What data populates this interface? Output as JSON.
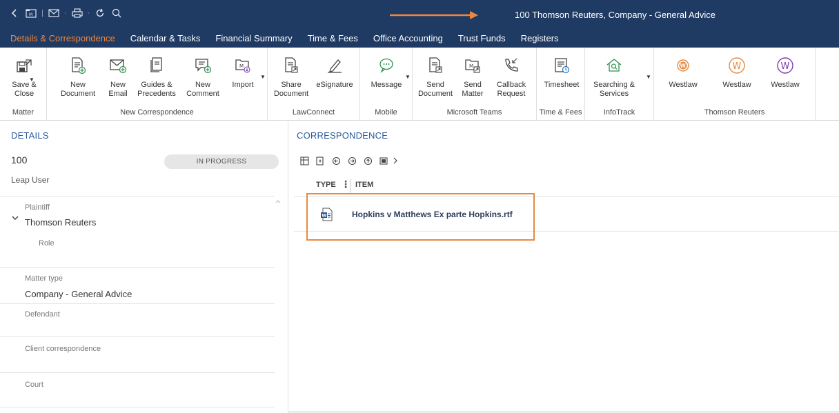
{
  "window": {
    "title": "100 Thomson Reuters, Company - General Advice"
  },
  "quick_access": {
    "icons": [
      "back-icon",
      "matter-icon",
      "email-icon",
      "print-icon",
      "refresh-icon",
      "search-icon"
    ]
  },
  "tabs": [
    {
      "label": "Details & Correspondence",
      "active": true
    },
    {
      "label": "Calendar & Tasks"
    },
    {
      "label": "Financial Summary"
    },
    {
      "label": "Time & Fees"
    },
    {
      "label": "Office Accounting"
    },
    {
      "label": "Trust Funds"
    },
    {
      "label": "Registers"
    }
  ],
  "ribbon": {
    "groups": {
      "matter": {
        "label": "Matter",
        "buttons": [
          {
            "label": "Save &\nClose"
          }
        ]
      },
      "new_correspondence": {
        "label": "New Correspondence",
        "buttons": [
          {
            "label": "New\nDocument"
          },
          {
            "label": "New\nEmail"
          },
          {
            "label": "Guides &\nPrecedents"
          },
          {
            "label": "New\nComment"
          },
          {
            "label": "Import"
          }
        ]
      },
      "lawconnect": {
        "label": "LawConnect",
        "buttons": [
          {
            "label": "Share\nDocument"
          },
          {
            "label": "eSignature"
          }
        ]
      },
      "mobile": {
        "label": "Mobile",
        "buttons": [
          {
            "label": "Message"
          }
        ]
      },
      "teams": {
        "label": "Microsoft Teams",
        "buttons": [
          {
            "label": "Send\nDocument"
          },
          {
            "label": "Send\nMatter"
          },
          {
            "label": "Callback\nRequest"
          }
        ]
      },
      "time_fees": {
        "label": "Time & Fees",
        "buttons": [
          {
            "label": "Timesheet"
          }
        ]
      },
      "infotrack": {
        "label": "InfoTrack",
        "buttons": [
          {
            "label": "Searching &\nServices"
          }
        ]
      },
      "thomson": {
        "label": "Thomson Reuters",
        "buttons": [
          {
            "label": "Westlaw"
          },
          {
            "label": "Westlaw"
          },
          {
            "label": "Westlaw"
          }
        ]
      }
    }
  },
  "details": {
    "title": "DETAILS",
    "matter_number": "100",
    "status": "IN PROGRESS",
    "user": "Leap User",
    "fields": {
      "plaintiff_label": "Plaintiff",
      "plaintiff_value": "Thomson Reuters",
      "role_label": "Role",
      "matter_type_label": "Matter type",
      "matter_type_value": "Company - General Advice",
      "defendant_label": "Defendant",
      "client_corr_label": "Client correspondence",
      "court_label": "Court"
    }
  },
  "correspondence": {
    "title": "CORRESPONDENCE",
    "columns": {
      "type": "TYPE",
      "item": "ITEM"
    },
    "rows": [
      {
        "type_icon": "word-document-icon",
        "name": "Hopkins v Matthews Ex parte Hopkins.rtf"
      }
    ]
  },
  "colors": {
    "header_bg": "#1f3b63",
    "accent_orange": "#f0863b",
    "section_title": "#2a5a9a"
  }
}
